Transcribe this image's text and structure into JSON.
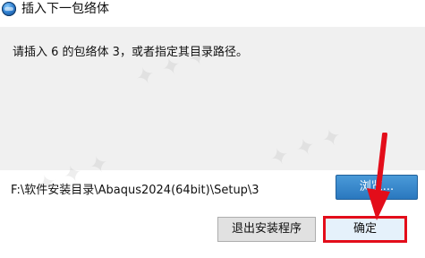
{
  "window": {
    "title": "插入下一包络体",
    "app_icon": "abaqus-globe-icon"
  },
  "dialog": {
    "message": "请插入 6 的包络体 3，或者指定其目录路径。",
    "path": "F:\\软件安装目录\\Abaqus2024(64bit)\\Setup\\3",
    "browse_label": "浏览...",
    "exit_label": "退出安装程序",
    "ok_label": "确定"
  },
  "annotations": {
    "highlight_color": "#e30d1a",
    "arrow_icon": "red-arrow-down-icon"
  },
  "colors": {
    "accent": "#0078d7",
    "browse_button_bg": "#2a78bf",
    "panel_bg": "#f0f0f0"
  }
}
